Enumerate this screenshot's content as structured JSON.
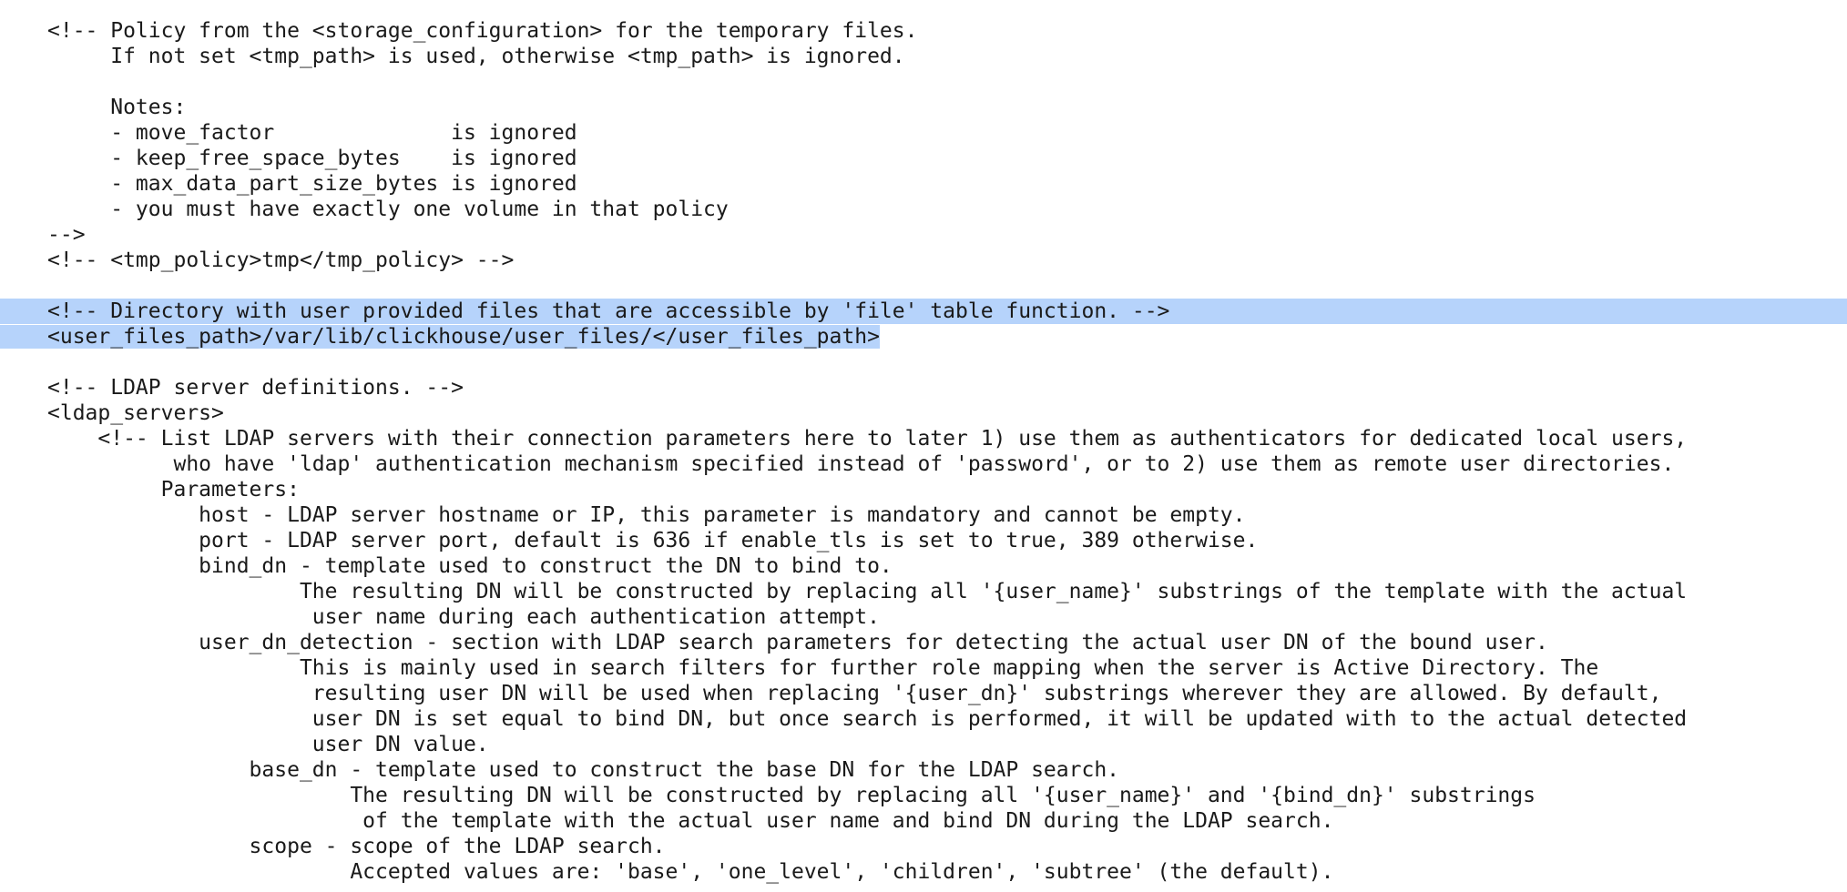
{
  "document": {
    "lines": [
      "<!-- Policy from the <storage_configuration> for the temporary files.",
      "     If not set <tmp_path> is used, otherwise <tmp_path> is ignored.",
      "",
      "     Notes:",
      "     - move_factor              is ignored",
      "     - keep_free_space_bytes    is ignored",
      "     - max_data_part_size_bytes is ignored",
      "     - you must have exactly one volume in that policy",
      "-->",
      "<!-- <tmp_policy>tmp</tmp_policy> -->",
      "",
      "<!-- Directory with user provided files that are accessible by 'file' table function. -->",
      "<user_files_path>/var/lib/clickhouse/user_files/</user_files_path>",
      "",
      "<!-- LDAP server definitions. -->",
      "<ldap_servers>",
      "    <!-- List LDAP servers with their connection parameters here to later 1) use them as authenticators for dedicated local users,",
      "          who have 'ldap' authentication mechanism specified instead of 'password', or to 2) use them as remote user directories.",
      "         Parameters:",
      "            host - LDAP server hostname or IP, this parameter is mandatory and cannot be empty.",
      "            port - LDAP server port, default is 636 if enable_tls is set to true, 389 otherwise.",
      "            bind_dn - template used to construct the DN to bind to.",
      "                    The resulting DN will be constructed by replacing all '{user_name}' substrings of the template with the actual",
      "                     user name during each authentication attempt.",
      "            user_dn_detection - section with LDAP search parameters for detecting the actual user DN of the bound user.",
      "                    This is mainly used in search filters for further role mapping when the server is Active Directory. The",
      "                     resulting user DN will be used when replacing '{user_dn}' substrings wherever they are allowed. By default,",
      "                     user DN is set equal to bind DN, but once search is performed, it will be updated with to the actual detected",
      "                     user DN value.",
      "                base_dn - template used to construct the base DN for the LDAP search.",
      "                        The resulting DN will be constructed by replacing all '{user_name}' and '{bind_dn}' substrings",
      "                         of the template with the actual user name and bind DN during the LDAP search.",
      "                scope - scope of the LDAP search.",
      "                        Accepted values are: 'base', 'one_level', 'children', 'subtree' (the default)."
    ],
    "selection": {
      "highlight_color": "#b6d3fb",
      "selected_lines": [
        11,
        12
      ]
    }
  }
}
